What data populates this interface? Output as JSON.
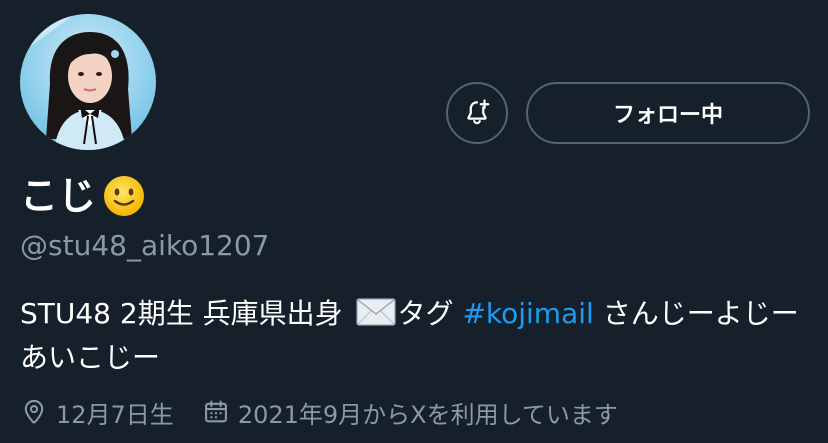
{
  "profile": {
    "display_name": "こじ",
    "name_emoji": "slightly-smiling-face",
    "handle": "@stu48_aiko1207",
    "bio": {
      "text_before": "STU48 2期生 兵庫県出身 ",
      "emoji": "envelope",
      "text_mid": "タグ ",
      "hashtag": "#kojimail",
      "text_after": " さんじーよじーあいこじー"
    },
    "birthday": "12月7日生",
    "joined": "2021年9月からXを利用しています"
  },
  "actions": {
    "notify_icon": "bell-plus-icon",
    "follow_label": "フォロー中"
  },
  "colors": {
    "background": "#15202b",
    "text": "#ffffff",
    "secondary": "#8b98a5",
    "border": "#536471",
    "link": "#1d9bf0"
  }
}
